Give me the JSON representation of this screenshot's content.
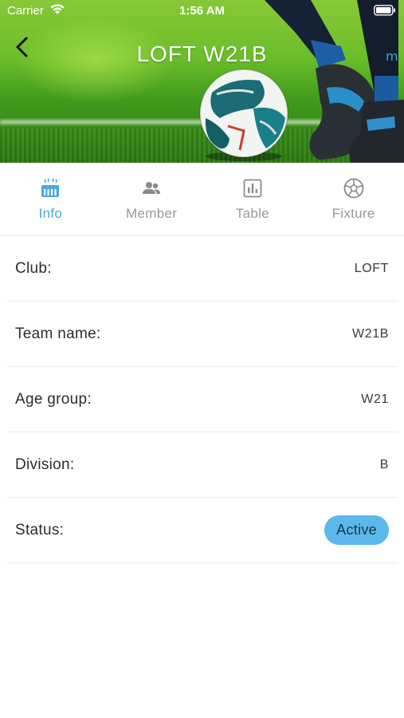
{
  "status_bar": {
    "carrier": "Carrier",
    "time": "1:56 AM"
  },
  "header": {
    "title": "LOFT W21B"
  },
  "tabs": [
    {
      "label": "Info",
      "icon": "stadium-icon",
      "active": true
    },
    {
      "label": "Member",
      "icon": "people-icon",
      "active": false
    },
    {
      "label": "Table",
      "icon": "chart-icon",
      "active": false
    },
    {
      "label": "Fixture",
      "icon": "soccer-ball-icon",
      "active": false
    }
  ],
  "info": {
    "club": {
      "label": "Club:",
      "value": "LOFT"
    },
    "team_name": {
      "label": "Team name:",
      "value": "W21B"
    },
    "age_group": {
      "label": "Age group:",
      "value": "W21"
    },
    "division": {
      "label": "Division:",
      "value": "B"
    },
    "status": {
      "label": "Status:",
      "value": "Active"
    }
  },
  "colors": {
    "accent": "#4aa8e0",
    "badge": "#5bb8ea",
    "inactive": "#9a9a9a"
  }
}
